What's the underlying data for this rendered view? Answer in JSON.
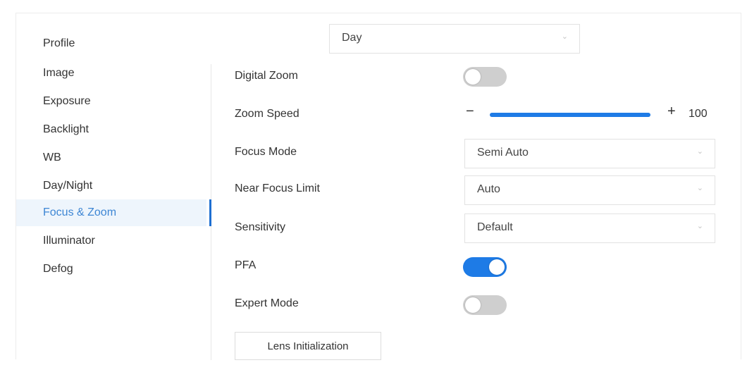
{
  "profile": {
    "label": "Profile",
    "value": "Day"
  },
  "sidebar": {
    "items": [
      {
        "label": "Image"
      },
      {
        "label": "Exposure"
      },
      {
        "label": "Backlight"
      },
      {
        "label": "WB"
      },
      {
        "label": "Day/Night"
      },
      {
        "label": "Focus & Zoom",
        "active": true
      },
      {
        "label": "Illuminator"
      },
      {
        "label": "Defog"
      }
    ]
  },
  "form": {
    "digital_zoom": {
      "label": "Digital Zoom",
      "enabled": false
    },
    "zoom_speed": {
      "label": "Zoom Speed",
      "minus": "−",
      "plus": "+",
      "value": 100,
      "value_text": "100"
    },
    "focus_mode": {
      "label": "Focus Mode",
      "value": "Semi Auto"
    },
    "near_focus_limit": {
      "label": "Near Focus Limit",
      "value": "Auto"
    },
    "sensitivity": {
      "label": "Sensitivity",
      "value": "Default"
    },
    "pfa": {
      "label": "PFA",
      "enabled": true
    },
    "expert_mode": {
      "label": "Expert Mode",
      "enabled": false
    },
    "lens_init_button": "Lens Initialization"
  },
  "colors": {
    "accent": "#1e7be6",
    "active_text": "#3d86d4",
    "toggle_off": "#cfcfcf",
    "active_bg": "#eef5fc"
  }
}
